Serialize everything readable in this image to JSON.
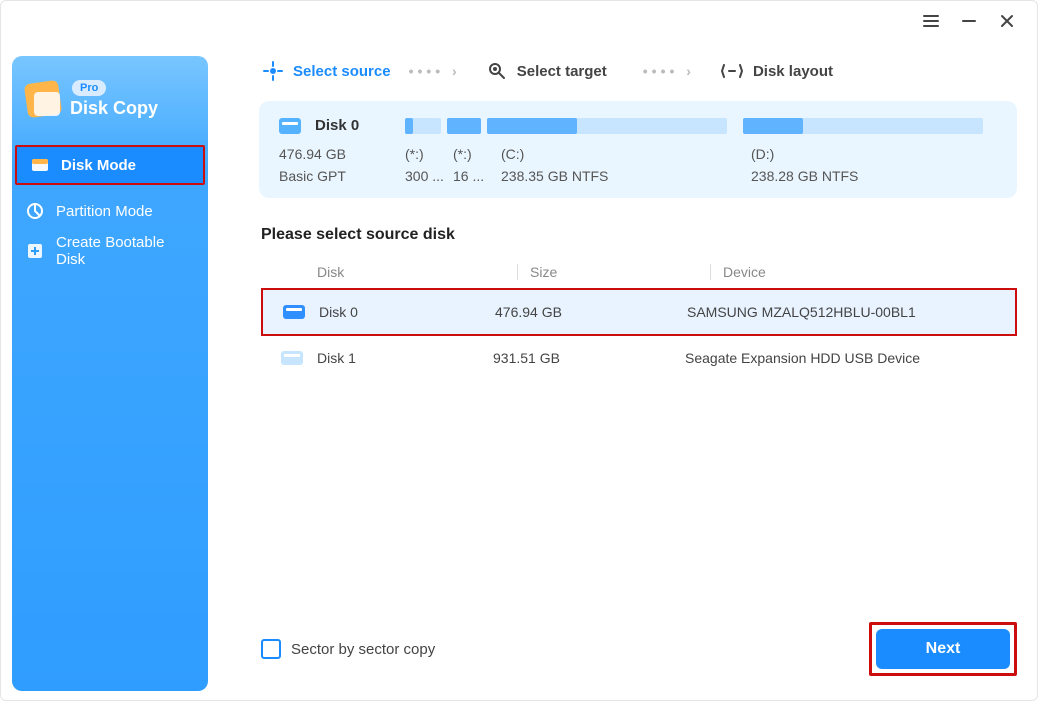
{
  "titlebar": {
    "menu": "≡",
    "min": "—",
    "close": "✕"
  },
  "sidebar": {
    "badge": "Pro",
    "app_name": "Disk Copy",
    "items": [
      {
        "label": "Disk Mode",
        "active": true
      },
      {
        "label": "Partition Mode",
        "active": false
      },
      {
        "label": "Create Bootable Disk",
        "active": false
      }
    ]
  },
  "steps": {
    "s1": "Select source",
    "s2": "Select target",
    "s3": "Disk layout"
  },
  "selected_disk": {
    "name": "Disk 0",
    "size": "476.94 GB",
    "scheme": "Basic GPT",
    "partitions": [
      {
        "label": "(*:)",
        "detail": "300 ..."
      },
      {
        "label": "(*:)",
        "detail": "16 ..."
      },
      {
        "label": "(C:)",
        "detail": "238.35 GB NTFS"
      },
      {
        "label": "(D:)",
        "detail": "238.28 GB NTFS"
      }
    ]
  },
  "section_title": "Please select source disk",
  "table": {
    "headers": {
      "disk": "Disk",
      "size": "Size",
      "device": "Device"
    },
    "rows": [
      {
        "name": "Disk 0",
        "size": "476.94 GB",
        "device": "SAMSUNG MZALQ512HBLU-00BL1",
        "selected": true
      },
      {
        "name": "Disk 1",
        "size": "931.51 GB",
        "device": "Seagate  Expansion HDD   USB Device",
        "selected": false
      }
    ]
  },
  "footer": {
    "sector_copy": "Sector by sector copy",
    "next": "Next"
  }
}
